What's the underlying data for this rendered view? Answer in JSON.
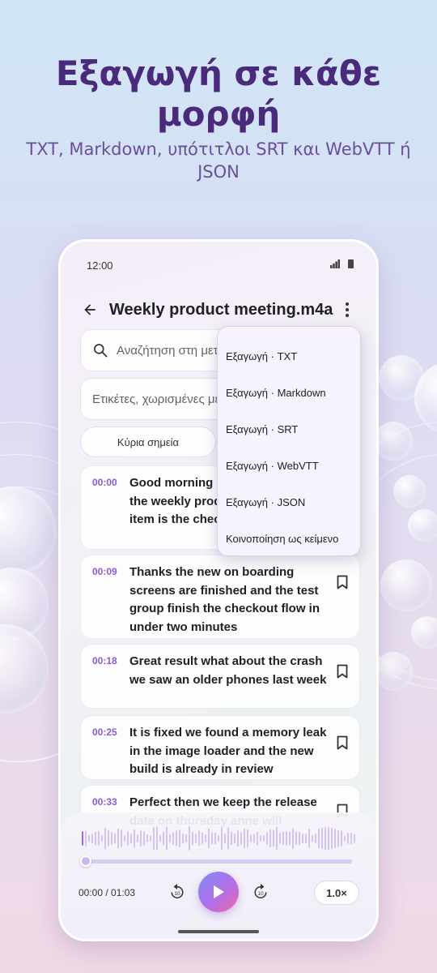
{
  "promo": {
    "headline_line1": "Εξαγωγή σε κάθε",
    "headline_line2": "μορφή",
    "subline_line1": "TXT, Markdown, υπότιτλοι SRT και WebVTT ή",
    "subline_line2": "JSON"
  },
  "status_bar": {
    "time": "12:00"
  },
  "app_bar": {
    "title": "Weekly product meeting.m4a"
  },
  "search": {
    "placeholder": "Αναζήτηση στη μεταγραφή"
  },
  "tags": {
    "placeholder": "Ετικέτες, χωρισμένες με κόμμα"
  },
  "filter_chip": {
    "label": "Κύρια σημεία"
  },
  "overflow_menu": {
    "items": [
      {
        "label": "Εξαγωγή · TXT"
      },
      {
        "label": "Εξαγωγή · Markdown"
      },
      {
        "label": "Εξαγωγή · SRT"
      },
      {
        "label": "Εξαγωγή · WebVTT"
      },
      {
        "label": "Εξαγωγή · JSON"
      },
      {
        "label": "Κοινοποίηση ως κείμενο"
      }
    ]
  },
  "segments": [
    {
      "time": "00:00",
      "text": "Good morning everyone let's start the weekly product sync the first item is the checkout launch"
    },
    {
      "time": "00:09",
      "text": "Thanks the new on boarding screens are finished and the test group finish the checkout flow in under two minutes"
    },
    {
      "time": "00:18",
      "text": "Great result what about the crash we saw an older phones last week"
    },
    {
      "time": "00:25",
      "text": "It is fixed we found a memory leak in the image loader and the new build is already in review"
    },
    {
      "time": "00:33",
      "text": "Perfect then we keep the release date on thursday anne will"
    }
  ],
  "player": {
    "current_time": "00:00",
    "duration": "01:03",
    "timecode": "00:00 / 01:03",
    "progress": 0,
    "speed": "1.0×",
    "rewind_seconds": "10",
    "forward_seconds": "10"
  },
  "colors": {
    "headline": "#4a2a7a",
    "accent": "#8a5bd6",
    "play_gradient": [
      "#7b8ef5",
      "#b36ee8",
      "#ec6aa8"
    ]
  },
  "icons": {
    "back": "arrow-left-icon",
    "more": "more-vert-icon",
    "search": "search-icon",
    "bookmark": "bookmark-icon",
    "play": "play-icon",
    "rewind": "replay-10-icon",
    "forward": "forward-10-icon"
  }
}
